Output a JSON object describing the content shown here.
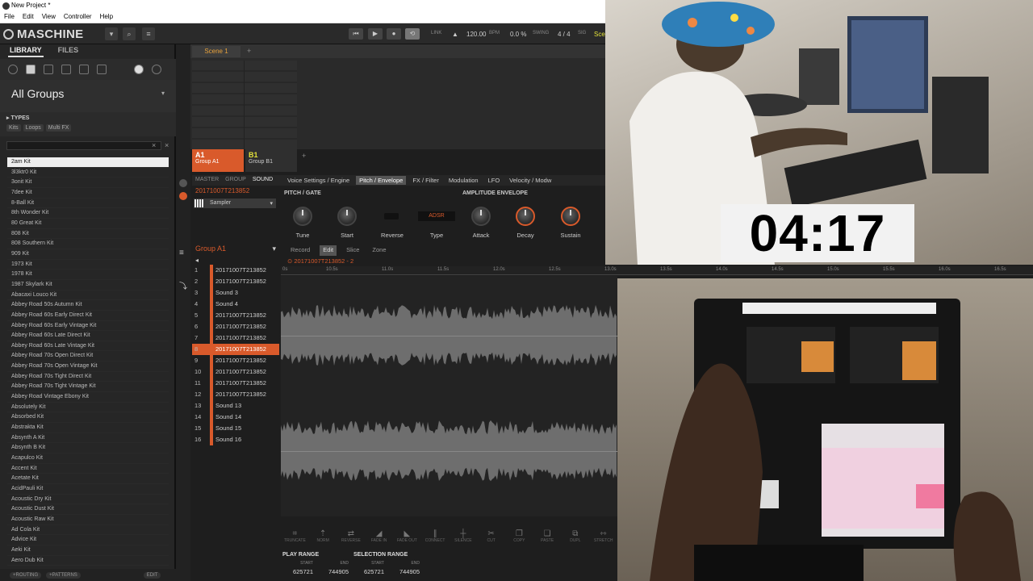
{
  "window": {
    "title": "New Project *"
  },
  "menu": [
    "File",
    "Edit",
    "View",
    "Controller",
    "Help"
  ],
  "header": {
    "logo": "MASCHINE",
    "link": "LINK",
    "bpm": "120.00",
    "bpm_unit": "BPM",
    "swing": "0.0 %",
    "swing_label": "SWING",
    "signature": "4 / 4",
    "sig_label": "SIG",
    "scene": "Sce"
  },
  "library": {
    "tabs": [
      "LIBRARY",
      "FILES"
    ],
    "group_title": "All Groups",
    "types_label": "TYPES",
    "type_chips": [
      "Kits",
      "Loops",
      "Multi FX"
    ],
    "items": [
      "2am Kit",
      "3l3ktr0 Kit",
      "3onit Kit",
      "7dee Kit",
      "8-Ball Kit",
      "8th Wonder Kit",
      "80 Great Kit",
      "808 Kit",
      "808 Southern Kit",
      "909 Kit",
      "1973 Kit",
      "1978 Kit",
      "1987 Skylark Kit",
      "Abacaxi Louco Kit",
      "Abbey Road 50s Autumn Kit",
      "Abbey Road 60s Early Direct Kit",
      "Abbey Road 60s Early Vintage Kit",
      "Abbey Road 60s Late Direct Kit",
      "Abbey Road 60s Late Vintage Kit",
      "Abbey Road 70s Open Direct Kit",
      "Abbey Road 70s Open Vintage Kit",
      "Abbey Road 70s Tight Direct Kit",
      "Abbey Road 70s Tight Vintage Kit",
      "Abbey Road Vintage Ebony Kit",
      "Absolutely Kit",
      "Absorbed Kit",
      "Abstrakta Kit",
      "Absynth A Kit",
      "Absynth B Kit",
      "Acapulco Kit",
      "Accent Kit",
      "Acetate Kit",
      "AcidPauli Kit",
      "Acoustic Dry Kit",
      "Acoustic Dust Kit",
      "Acoustic Raw Kit",
      "Ad Cola Kit",
      "Advice Kit",
      "Aeki Kit",
      "Aero Dub Kit"
    ],
    "footer": [
      "+ROUTING",
      "+PATTERNS",
      "EDIT"
    ]
  },
  "arranger": {
    "scene": "Scene 1"
  },
  "groups": [
    {
      "id": "A1",
      "name": "Group A1"
    },
    {
      "id": "B1",
      "name": "Group B1"
    }
  ],
  "control": {
    "levels": [
      "MASTER",
      "GROUP",
      "SOUND"
    ],
    "pages": [
      "Voice Settings / Engine",
      "Pitch / Envelope",
      "FX / Filter",
      "Modulation",
      "LFO",
      "Velocity / Modw"
    ],
    "sound_name": "20171007T213852",
    "pitch_label": "PITCH / GATE",
    "amp_label": "AMPLITUDE ENVELOPE",
    "sampler": "Sampler",
    "adsr": "ADSR",
    "knobs": [
      "Tune",
      "Start",
      "Reverse",
      "Type",
      "Attack",
      "Decay",
      "Sustain"
    ]
  },
  "pads": {
    "group": "Group A1",
    "items": [
      "20171007T213852",
      "20171007T213852",
      "Sound 3",
      "Sound 4",
      "20171007T213852",
      "20171007T213852",
      "20171007T213852",
      "20171007T213852",
      "20171007T213852",
      "20171007T213852",
      "20171007T213852",
      "20171007T213852",
      "Sound 13",
      "Sound 14",
      "Sound 15",
      "Sound 16"
    ]
  },
  "editor": {
    "tabs": [
      "Record",
      "Edit",
      "Slice",
      "Zone"
    ],
    "sample": "20171007T213852 - 2",
    "ruler": [
      "0s",
      "10.5s",
      "11.0s",
      "11.5s",
      "12.0s",
      "12.5s",
      "13.0s",
      "13.5s",
      "14.0s",
      "14.5s",
      "15.0s",
      "15.5s",
      "16.0s",
      "16.5s"
    ],
    "tools": [
      "TRUNCATE",
      "NORM",
      "REVERSE",
      "FADE IN",
      "FADE OUT",
      "CONNECT",
      "SILENCE",
      "CUT",
      "COPY",
      "PASTE",
      "DUPL",
      "STRETCH"
    ],
    "play_range": {
      "label": "PLAY RANGE",
      "start_label": "START",
      "end_label": "END",
      "start": "625721",
      "end": "744905"
    },
    "selection_range": {
      "label": "SELECTION RANGE",
      "start_label": "START",
      "end_label": "END",
      "start": "625721",
      "end": "744905"
    }
  },
  "timer": "04:17",
  "colors": {
    "accent": "#d95a2b",
    "group_b": "#e3e23a"
  }
}
